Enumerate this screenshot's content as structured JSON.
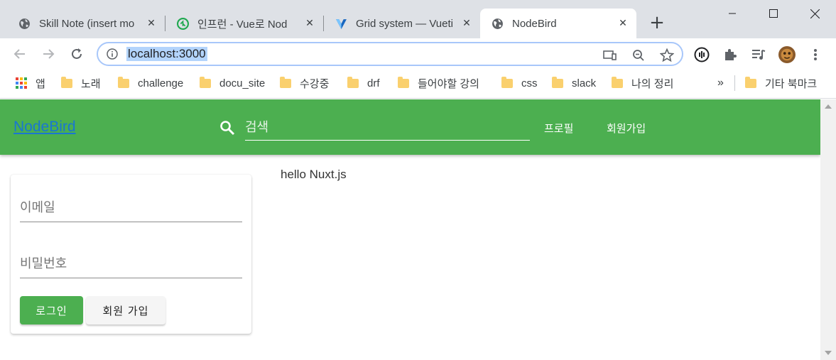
{
  "browser": {
    "tabs": [
      {
        "title": "Skill Note (insert mo",
        "favicon": "globe-icon",
        "active": false
      },
      {
        "title": "인프런 - Vue로 Nod",
        "favicon": "inflearn-icon",
        "active": false
      },
      {
        "title": "Grid system — Vueti",
        "favicon": "vuetify-icon",
        "active": false
      },
      {
        "title": "NodeBird",
        "favicon": "globe-icon",
        "active": true
      }
    ],
    "url": "localhost:3000",
    "bookmarks": [
      {
        "label": "앱",
        "type": "apps"
      },
      {
        "label": "노래",
        "type": "folder"
      },
      {
        "label": "challenge",
        "type": "folder"
      },
      {
        "label": "docu_site",
        "type": "folder"
      },
      {
        "label": "수강중",
        "type": "folder"
      },
      {
        "label": "drf",
        "type": "folder"
      },
      {
        "label": "들어야할 강의",
        "type": "folder"
      },
      {
        "label": "css",
        "type": "folder"
      },
      {
        "label": "slack",
        "type": "folder"
      },
      {
        "label": "나의 정리",
        "type": "folder"
      }
    ],
    "bookmarks_overflow": "»",
    "other_bookmarks": "기타 북마크",
    "colors": {
      "tabstrip": "#dee1e6",
      "active_tab": "#ffffff",
      "folder": "#fad06e"
    }
  },
  "app": {
    "brand": "NodeBird",
    "search": {
      "placeholder": "검색",
      "icon": "search-icon"
    },
    "nav": {
      "profile": "프로필",
      "signup": "회원가입"
    },
    "colors": {
      "appbar": "#4caf50",
      "brand_link": "#1976d2",
      "primary_button": "#4caf50"
    }
  },
  "login": {
    "email_placeholder": "이메일",
    "password_placeholder": "비밀번호",
    "login_button": "로그인",
    "signup_button": "회원 가입"
  },
  "main": {
    "text": "hello Nuxt.js"
  }
}
